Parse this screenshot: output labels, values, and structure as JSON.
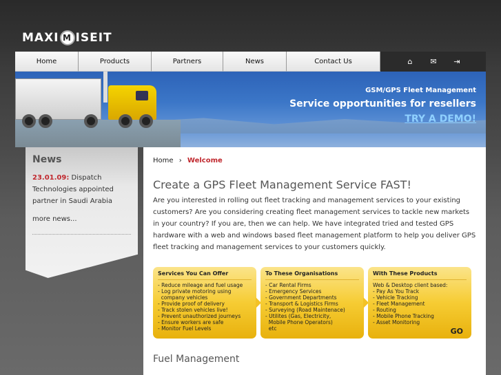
{
  "logo": {
    "before": "MAXI",
    "badge": "M",
    "after": "ISEIT"
  },
  "nav": {
    "items": [
      {
        "label": "Home"
      },
      {
        "label": "Products"
      },
      {
        "label": "Partners"
      },
      {
        "label": "News"
      },
      {
        "label": "Contact Us"
      }
    ],
    "icons": [
      {
        "name": "home-icon",
        "glyph": "⌂"
      },
      {
        "name": "mail-icon",
        "glyph": "✉"
      },
      {
        "name": "login-icon",
        "glyph": "⇥"
      }
    ]
  },
  "banner": {
    "subtitle": "GSM/GPS Fleet Management",
    "title": "Service opportunities for resellers",
    "cta": "TRY A DEMO!"
  },
  "sidebar": {
    "heading": "News",
    "news_date": "23.01.09:",
    "news_text": " Dispatch Technologies appointed partner in Saudi Arabia",
    "more": "more news..."
  },
  "breadcrumb": {
    "home": "Home",
    "sep": "›",
    "current": "Welcome"
  },
  "main": {
    "heading": "Create a GPS Fleet Management Service FAST!",
    "intro": "Are you interested in rolling out fleet tracking and management services to your existing customers? Are you considering creating fleet management services to tackle new markets in your country? If you are, then we can help. We have integrated tried and tested GPS hardware with a web and windows based fleet management platform to help you deliver GPS fleet tracking and management services to your customers quickly.",
    "boxes": [
      {
        "title": "Services You Can Offer",
        "items": [
          "- Reduce mileage and fuel usage",
          "- Log private motoring using",
          "  company vehicles",
          "- Provide proof of delivery",
          "- Track stolen vehicles live!",
          "- Prevent unauthorized journeys",
          "- Ensure workers are safe",
          "- Monitor Fuel Levels"
        ]
      },
      {
        "title": "To These Organisations",
        "items": [
          "- Car Rental Firms",
          "- Emergency Services",
          "- Government Departments",
          "- Transport & Logistics Firms",
          "- Surveying (Road Maintenace)",
          "- Utilites (Gas, Electricity,",
          "  Mobile Phone Operators)",
          "  etc"
        ]
      },
      {
        "title": "With These Products",
        "items": [
          "Web & Desktop client based:",
          "- Pay As You Track",
          "- Vehicle Tracking",
          "- Fleet Management",
          "- Routing",
          "- Mobile Phone Tracking",
          "- Asset Monitoring"
        ],
        "go": "GO"
      }
    ],
    "subheading": "Fuel Management"
  }
}
